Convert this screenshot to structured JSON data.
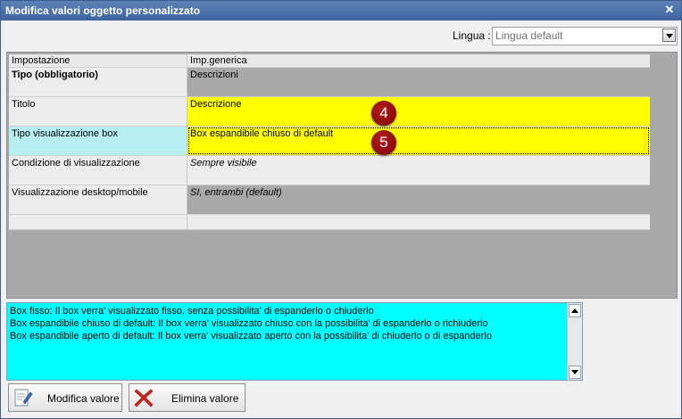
{
  "window": {
    "title": "Modifica valori oggetto personalizzato",
    "close_icon": "close-icon"
  },
  "language": {
    "label": "Lingua :",
    "value": "Lingua default"
  },
  "grid": {
    "headers": [
      "Impostazione",
      "Imp.generica"
    ],
    "rows": [
      {
        "setting": "Tipo (obbligatorio)",
        "value": "Descrizioni"
      },
      {
        "setting": "Titolo",
        "value": "Descrizione"
      },
      {
        "setting": "Tipo visualizzazione box",
        "value": "Box espandibile chiuso di default"
      },
      {
        "setting": "Condizione di visualizzazione",
        "value": "Sempre visibile"
      },
      {
        "setting": "Visualizzazione desktop/mobile",
        "value": "SI, entrambi (default)"
      },
      {
        "setting": "",
        "value": ""
      }
    ]
  },
  "markers": [
    "4",
    "5"
  ],
  "description": {
    "lines": [
      "Box fisso: Il box verra' visualizzato fisso, senza possibilita' di espanderlo o chiuderlo",
      "Box espandibile chiuso di default: Il box verra' visualizzato chiuso con la possibilita' di espanderlo o richiuderlo",
      "Box espandibile aperto di default: Il box verra' visualizzato aperto con la possibilita' di chiuderlo o di espanderlo"
    ]
  },
  "buttons": {
    "edit": "Modifica valore",
    "delete": "Elimina valore"
  },
  "colors": {
    "highlight_yellow": "#ffff00",
    "selected_row": "#b6eef2",
    "description_bg": "#00ffff",
    "marker_red": "#8b0000"
  }
}
